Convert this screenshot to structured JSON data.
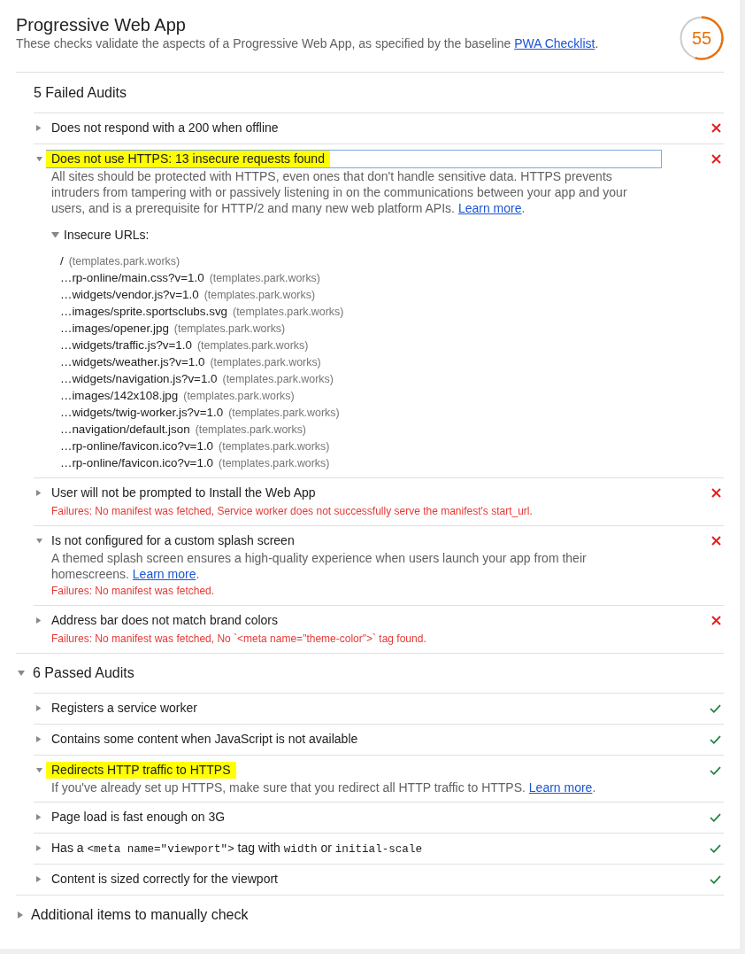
{
  "report": {
    "title": "Progressive Web App",
    "description": "These checks validate the aspects of a Progressive Web App, as specified by the baseline ",
    "link": "PWA Checklist",
    "description_end": "."
  },
  "score": {
    "value": "55"
  },
  "sections": [
    {
      "title": "5 Failed Audits",
      "collapsible": false,
      "expanded": true,
      "audits": [
        {
          "title": "Does not respond with a 200 when offline",
          "kind": "fail",
          "expanded": false,
          "highlighted": false,
          "focused": false
        },
        {
          "title": "Does not use HTTPS: 13 insecure requests found",
          "kind": "fail",
          "expanded": true,
          "highlighted": true,
          "focused": true,
          "description": "All sites should be protected with HTTPS, even ones that don't handle sensitive data. HTTPS prevents intruders from tampering with or passively listening in on the communications between your app and your users, and is a prerequisite for HTTP/2 and many new web platform APIs. ",
          "link": "Learn more",
          "description_end": ".",
          "details": {
            "title": "Insecure URLs:",
            "expanded": true,
            "urls": [
              {
                "url": "/",
                "host": "(templates.park.works)"
              },
              {
                "url": "…rp-online/main.css?v=1.0",
                "host": "(templates.park.works)"
              },
              {
                "url": "…widgets/vendor.js?v=1.0",
                "host": "(templates.park.works)"
              },
              {
                "url": "…images/sprite.sportsclubs.svg",
                "host": "(templates.park.works)"
              },
              {
                "url": "…images/opener.jpg",
                "host": "(templates.park.works)"
              },
              {
                "url": "…widgets/traffic.js?v=1.0",
                "host": "(templates.park.works)"
              },
              {
                "url": "…widgets/weather.js?v=1.0",
                "host": "(templates.park.works)"
              },
              {
                "url": "…widgets/navigation.js?v=1.0",
                "host": "(templates.park.works)"
              },
              {
                "url": "…images/142x108.jpg",
                "host": "(templates.park.works)"
              },
              {
                "url": "…widgets/twig-worker.js?v=1.0",
                "host": "(templates.park.works)"
              },
              {
                "url": "…navigation/default.json",
                "host": "(templates.park.works)"
              },
              {
                "url": "…rp-online/favicon.ico?v=1.0",
                "host": "(templates.park.works)"
              },
              {
                "url": "…rp-online/favicon.ico?v=1.0",
                "host": "(templates.park.works)"
              }
            ]
          }
        },
        {
          "title": "User will not be prompted to Install the Web App",
          "kind": "fail",
          "expanded": false,
          "highlighted": false,
          "focused": false,
          "failures": "Failures: No manifest was fetched, Service worker does not successfully serve the manifest's start_url."
        },
        {
          "title": "Is not configured for a custom splash screen",
          "kind": "fail",
          "expanded": true,
          "highlighted": false,
          "focused": false,
          "description": "A themed splash screen ensures a high-quality experience when users launch your app from their homescreens. ",
          "link": "Learn more",
          "description_end": ".",
          "failures": "Failures: No manifest was fetched."
        },
        {
          "title": "Address bar does not match brand colors",
          "kind": "fail",
          "expanded": false,
          "highlighted": false,
          "focused": false,
          "failures": "Failures: No manifest was fetched, No `<meta name=\"theme-color\">` tag found."
        }
      ]
    },
    {
      "title": "6 Passed Audits",
      "collapsible": true,
      "expanded": true,
      "audits": [
        {
          "title": "Registers a service worker",
          "kind": "pass",
          "expanded": false,
          "highlighted": false,
          "focused": false
        },
        {
          "title": "Contains some content when JavaScript is not available",
          "kind": "pass",
          "expanded": false,
          "highlighted": false,
          "focused": false
        },
        {
          "title": "Redirects HTTP traffic to HTTPS",
          "kind": "pass",
          "expanded": true,
          "highlighted": true,
          "focused": false,
          "description": "If you've already set up HTTPS, make sure that you redirect all HTTP traffic to HTTPS. ",
          "link": "Learn more",
          "description_end": "."
        },
        {
          "title": "Page load is fast enough on 3G",
          "kind": "pass",
          "expanded": false,
          "highlighted": false,
          "focused": false
        },
        {
          "title_parts": [
            {
              "kind": "text",
              "text": "Has a "
            },
            {
              "kind": "code",
              "text": "<meta name=\"viewport\">"
            },
            {
              "kind": "text",
              "text": " tag with "
            },
            {
              "kind": "code",
              "text": "width"
            },
            {
              "kind": "text",
              "text": " or "
            },
            {
              "kind": "code",
              "text": "initial-scale"
            }
          ],
          "kind": "pass",
          "expanded": false,
          "highlighted": false,
          "focused": false
        },
        {
          "title": "Content is sized correctly for the viewport",
          "kind": "pass",
          "expanded": false,
          "highlighted": false,
          "focused": false
        }
      ]
    },
    {
      "title": "Additional items to manually check",
      "collapsible": true,
      "expanded": false
    }
  ]
}
